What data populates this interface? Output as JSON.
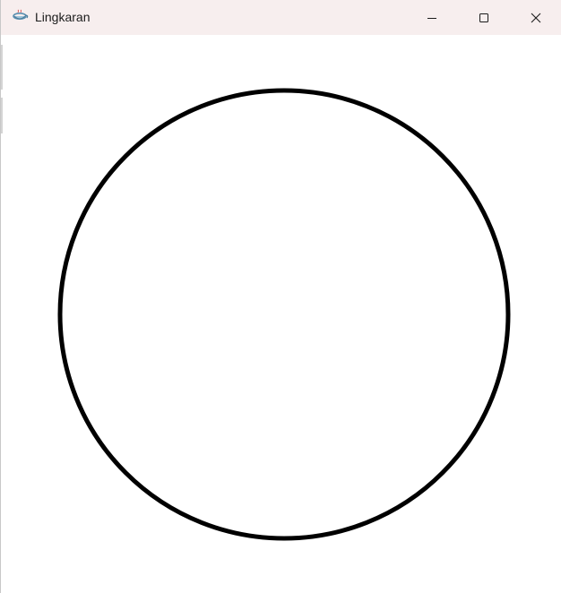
{
  "window": {
    "title": "Lingkaran",
    "app_icon": "java-cup-icon",
    "controls": {
      "minimize_icon": "minimize-icon",
      "maximize_icon": "maximize-icon",
      "close_icon": "close-icon"
    }
  },
  "canvas": {
    "shape": "circle",
    "stroke_color": "#000000",
    "fill_color": "#ffffff"
  },
  "colors": {
    "titlebar_background": "#f7eeee",
    "client_background": "#ffffff",
    "title_text": "#1b1b1b"
  }
}
